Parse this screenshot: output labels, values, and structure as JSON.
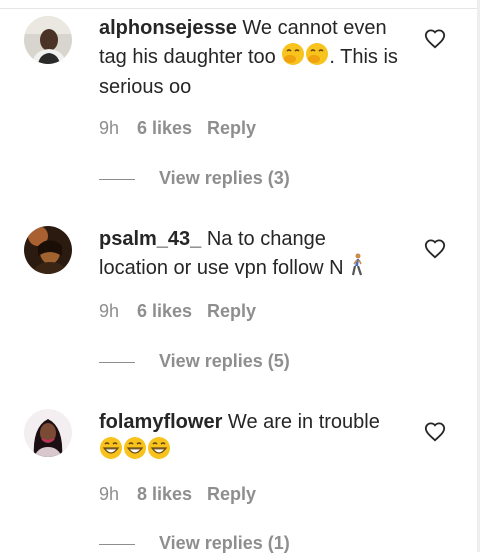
{
  "comments": [
    {
      "username": "alphonsejesse",
      "text_parts": [
        "We cannot even tag his daughter too ",
        ". This is serious oo"
      ],
      "emoji": [
        "face-with-hand-over-mouth",
        "face-with-hand-over-mouth"
      ],
      "time": "9h",
      "likes": "6 likes",
      "reply": "Reply",
      "view_replies": "View replies (3)"
    },
    {
      "username": "psalm_43_",
      "text": "Na to change location or use vpn follow N",
      "emoji": [
        "person-walking"
      ],
      "time": "9h",
      "likes": "6 likes",
      "reply": "Reply",
      "view_replies": "View replies (5)"
    },
    {
      "username": "folamyflower",
      "text": "We are in trouble",
      "emoji": [
        "grinning-face",
        "grinning-face",
        "grinning-face"
      ],
      "time": "9h",
      "likes": "8 likes",
      "reply": "Reply",
      "view_replies": "View replies (1)"
    }
  ],
  "colors": {
    "text": "#262626",
    "muted": "#8e8e8e",
    "emoji_yellow": "#f7c31c"
  },
  "icons": [
    "heart-outline-icon"
  ]
}
